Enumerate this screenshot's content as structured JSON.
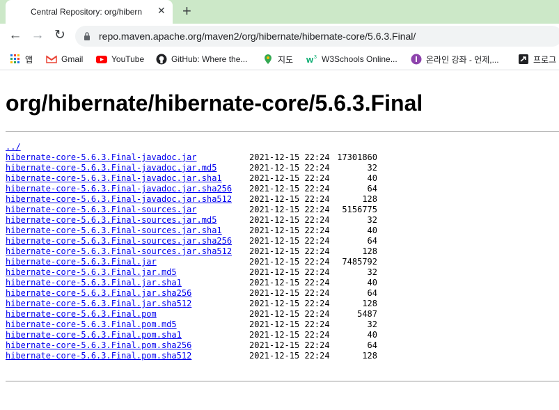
{
  "tab": {
    "title": "Central Repository: org/hibernate/hibernate-core",
    "close": "✕",
    "new_tab": "+"
  },
  "toolbar": {
    "url": "repo.maven.apache.org/maven2/org/hibernate/hibernate-core/5.6.3.Final/"
  },
  "bookmarks": [
    {
      "label": "앱",
      "icon": "apps-grid-icon"
    },
    {
      "label": "Gmail",
      "icon": "gmail-icon"
    },
    {
      "label": "YouTube",
      "icon": "youtube-icon"
    },
    {
      "label": "GitHub: Where the...",
      "icon": "github-icon"
    },
    {
      "label": "지도",
      "icon": "maps-pin-icon"
    },
    {
      "label": "W3Schools Online...",
      "icon": "w3schools-icon"
    },
    {
      "label": "온라인 강좌 - 언제,...",
      "icon": "inflearn-icon"
    },
    {
      "label": "프로그",
      "icon": "bookmark-arrow-icon"
    }
  ],
  "page": {
    "title": "org/hibernate/hibernate-core/5.6.3.Final",
    "parent_link": "../",
    "files": [
      {
        "name": "hibernate-core-5.6.3.Final-javadoc.jar",
        "date": "2021-12-15 22:24",
        "size": "17301860"
      },
      {
        "name": "hibernate-core-5.6.3.Final-javadoc.jar.md5",
        "date": "2021-12-15 22:24",
        "size": "32"
      },
      {
        "name": "hibernate-core-5.6.3.Final-javadoc.jar.sha1",
        "date": "2021-12-15 22:24",
        "size": "40"
      },
      {
        "name": "hibernate-core-5.6.3.Final-javadoc.jar.sha256",
        "date": "2021-12-15 22:24",
        "size": "64"
      },
      {
        "name": "hibernate-core-5.6.3.Final-javadoc.jar.sha512",
        "date": "2021-12-15 22:24",
        "size": "128"
      },
      {
        "name": "hibernate-core-5.6.3.Final-sources.jar",
        "date": "2021-12-15 22:24",
        "size": "5156775"
      },
      {
        "name": "hibernate-core-5.6.3.Final-sources.jar.md5",
        "date": "2021-12-15 22:24",
        "size": "32"
      },
      {
        "name": "hibernate-core-5.6.3.Final-sources.jar.sha1",
        "date": "2021-12-15 22:24",
        "size": "40"
      },
      {
        "name": "hibernate-core-5.6.3.Final-sources.jar.sha256",
        "date": "2021-12-15 22:24",
        "size": "64"
      },
      {
        "name": "hibernate-core-5.6.3.Final-sources.jar.sha512",
        "date": "2021-12-15 22:24",
        "size": "128"
      },
      {
        "name": "hibernate-core-5.6.3.Final.jar",
        "date": "2021-12-15 22:24",
        "size": "7485792"
      },
      {
        "name": "hibernate-core-5.6.3.Final.jar.md5",
        "date": "2021-12-15 22:24",
        "size": "32"
      },
      {
        "name": "hibernate-core-5.6.3.Final.jar.sha1",
        "date": "2021-12-15 22:24",
        "size": "40"
      },
      {
        "name": "hibernate-core-5.6.3.Final.jar.sha256",
        "date": "2021-12-15 22:24",
        "size": "64"
      },
      {
        "name": "hibernate-core-5.6.3.Final.jar.sha512",
        "date": "2021-12-15 22:24",
        "size": "128"
      },
      {
        "name": "hibernate-core-5.6.3.Final.pom",
        "date": "2021-12-15 22:24",
        "size": "5487"
      },
      {
        "name": "hibernate-core-5.6.3.Final.pom.md5",
        "date": "2021-12-15 22:24",
        "size": "32"
      },
      {
        "name": "hibernate-core-5.6.3.Final.pom.sha1",
        "date": "2021-12-15 22:24",
        "size": "40"
      },
      {
        "name": "hibernate-core-5.6.3.Final.pom.sha256",
        "date": "2021-12-15 22:24",
        "size": "64"
      },
      {
        "name": "hibernate-core-5.6.3.Final.pom.sha512",
        "date": "2021-12-15 22:24",
        "size": "128"
      }
    ]
  },
  "colors": {
    "link": "#0000ee",
    "tabstrip": "#cce8c8",
    "omnibox": "#f1f3f4"
  }
}
